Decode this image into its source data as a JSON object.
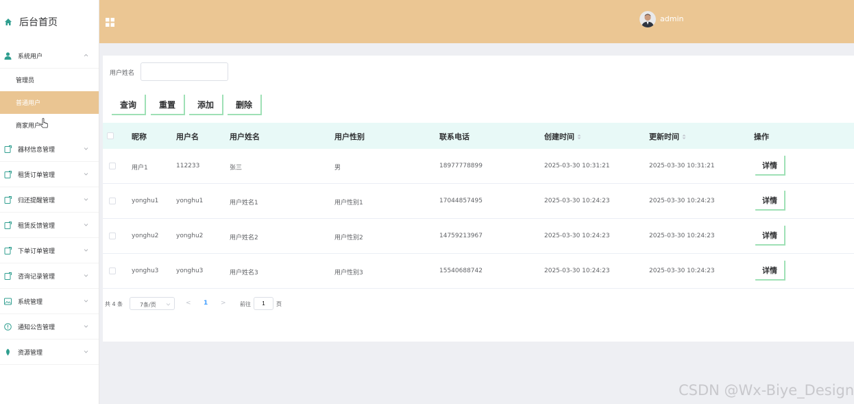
{
  "sidebar": {
    "brand": "后台首页",
    "menus": [
      {
        "label": "系统用户",
        "icon": "user-icon",
        "children": [
          "管理员",
          "普通用户",
          "商家用户"
        ]
      },
      {
        "label": "器材信息管理",
        "icon": "doc-icon"
      },
      {
        "label": "租赁订单管理",
        "icon": "doc-icon"
      },
      {
        "label": "归还提醒管理",
        "icon": "doc-icon"
      },
      {
        "label": "租赁反馈管理",
        "icon": "doc-icon"
      },
      {
        "label": "下单订单管理",
        "icon": "doc-icon"
      },
      {
        "label": "咨询记录管理",
        "icon": "doc-icon"
      },
      {
        "label": "系统管理",
        "icon": "image-icon"
      },
      {
        "label": "通知公告管理",
        "icon": "info-icon"
      },
      {
        "label": "资源管理",
        "icon": "leaf-icon"
      }
    ]
  },
  "header": {
    "username": "admin"
  },
  "search": {
    "label": "用户姓名",
    "value": "",
    "placeholder": ""
  },
  "toolbar": {
    "query": "查询",
    "reset": "重置",
    "add": "添加",
    "delete": "删除"
  },
  "table": {
    "columns": [
      "昵称",
      "用户名",
      "用户姓名",
      "用户性别",
      "联系电话",
      "创建时间",
      "更新时间",
      "操作"
    ],
    "rows": [
      {
        "nickname": "用户1",
        "username": "112233",
        "realname": "张三",
        "gender": "男",
        "phone": "18977778899",
        "created": "2025-03-30 10:31:21",
        "updated": "2025-03-30 10:31:21"
      },
      {
        "nickname": "yonghu1",
        "username": "yonghu1",
        "realname": "用户姓名1",
        "gender": "用户性别1",
        "phone": "17044857495",
        "created": "2025-03-30 10:24:23",
        "updated": "2025-03-30 10:24:23"
      },
      {
        "nickname": "yonghu2",
        "username": "yonghu2",
        "realname": "用户姓名2",
        "gender": "用户性别2",
        "phone": "14759213967",
        "created": "2025-03-30 10:24:23",
        "updated": "2025-03-30 10:24:23"
      },
      {
        "nickname": "yonghu3",
        "username": "yonghu3",
        "realname": "用户姓名3",
        "gender": "用户性别3",
        "phone": "15540688742",
        "created": "2025-03-30 10:24:23",
        "updated": "2025-03-30 10:24:23"
      }
    ],
    "detail_label": "详情"
  },
  "pagination": {
    "total": "共 4 条",
    "page_size": "7条/页",
    "prev": "<",
    "current_page": "1",
    "next": ">",
    "goto_label": "前往",
    "goto_value": "1",
    "page_unit": "页"
  },
  "watermark": "CSDN @Wx-Biye_Design",
  "colors": {
    "header": "#ebc693",
    "active_menu": "#eac592",
    "table_header": "#e8f9f7",
    "button_accent": "#9ee0b5",
    "sidebar_icon": "#2f9e8f",
    "page_active": "#409eff"
  }
}
